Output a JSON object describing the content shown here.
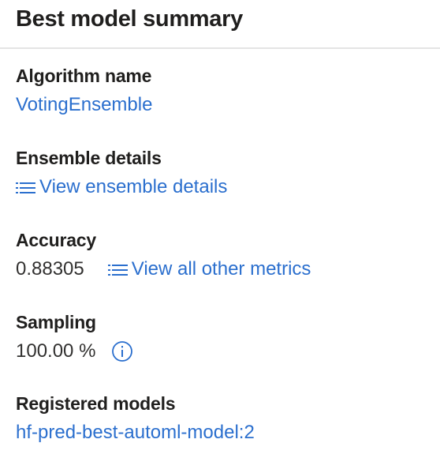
{
  "summary": {
    "title": "Best model summary"
  },
  "algorithm": {
    "label": "Algorithm name",
    "value": "VotingEnsemble"
  },
  "ensemble": {
    "label": "Ensemble details",
    "link": "View ensemble details"
  },
  "accuracy": {
    "label": "Accuracy",
    "value": "0.88305",
    "link": "View all other metrics"
  },
  "sampling": {
    "label": "Sampling",
    "value": "100.00 %"
  },
  "registered": {
    "label": "Registered models",
    "value": "hf-pred-best-automl-model:2"
  },
  "icons": {
    "list": "list-icon",
    "info": "info-icon"
  },
  "colors": {
    "link": "#2b6fce",
    "text": "#201f1e",
    "divider": "#e4e4e4"
  }
}
